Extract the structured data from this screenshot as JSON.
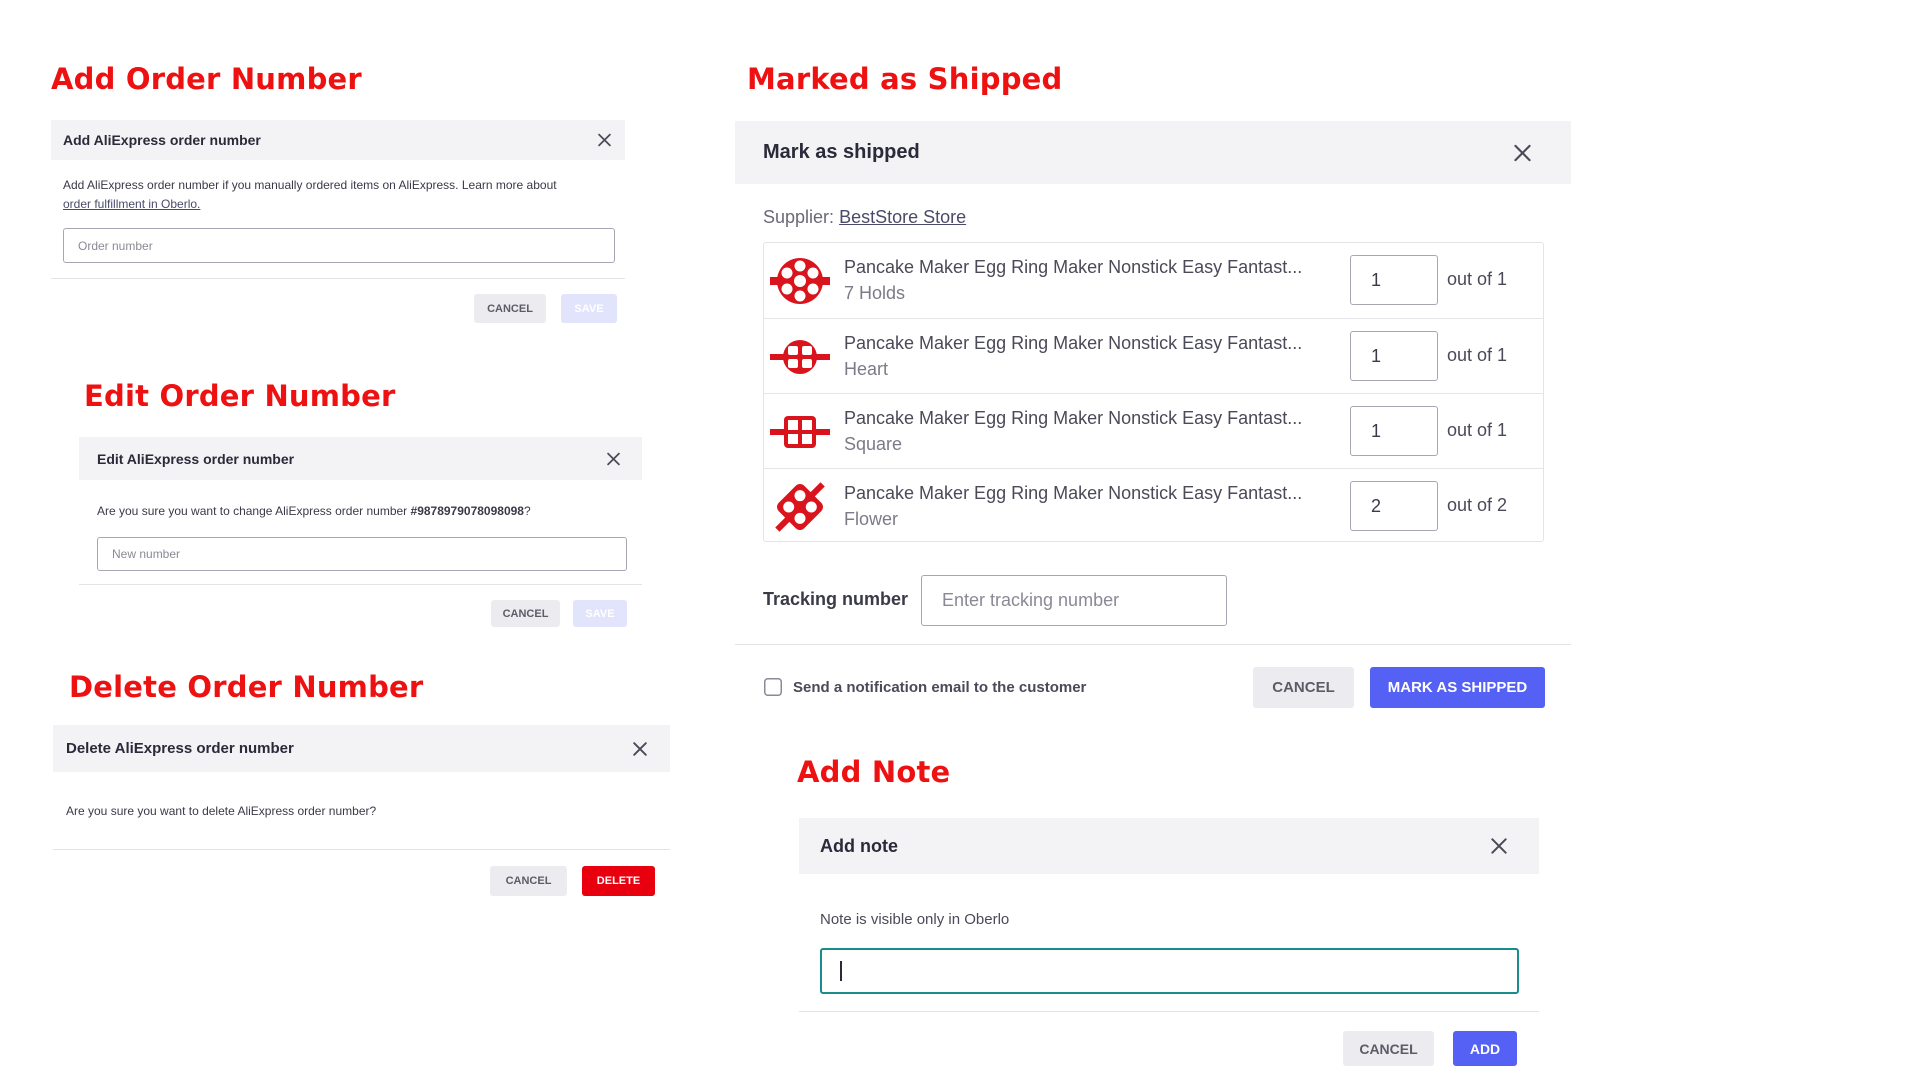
{
  "sections": {
    "add_order": "Add Order Number",
    "edit_order": "Edit Order Number",
    "delete_order": "Delete Order Number",
    "marked_shipped": "Marked as Shipped",
    "add_note": "Add Note"
  },
  "add_order_dialog": {
    "title": "Add AliExpress order number",
    "description": "Add AliExpress order number if you manually ordered items on AliExpress. Learn more about",
    "link_text": "order fulfillment in Oberlo.",
    "input_placeholder": "Order number",
    "cancel_label": "CANCEL",
    "save_label": "SAVE"
  },
  "edit_order_dialog": {
    "title": "Edit AliExpress order number",
    "question_prefix": "Are you sure you want to change AliExpress order number",
    "order_number": "#9878979078098098",
    "question_suffix": "?",
    "input_placeholder": "New number",
    "cancel_label": "CANCEL",
    "save_label": "SAVE"
  },
  "delete_order_dialog": {
    "title": "Delete AliExpress order number",
    "question": "Are you sure you want to delete AliExpress order number?",
    "cancel_label": "CANCEL",
    "delete_label": "DELETE"
  },
  "mark_shipped_dialog": {
    "title": "Mark as shipped",
    "supplier_label": "Supplier:",
    "supplier_name": "BestStore Store",
    "products": [
      {
        "name": "Pancake Maker Egg Ring Maker Nonstick Easy Fantast...",
        "variant": "7 Holds",
        "qty": "1",
        "of_text": "out of 1"
      },
      {
        "name": "Pancake Maker Egg Ring Maker Nonstick Easy Fantast...",
        "variant": "Heart",
        "qty": "1",
        "of_text": "out of 1"
      },
      {
        "name": "Pancake Maker Egg Ring Maker Nonstick Easy Fantast...",
        "variant": "Square",
        "qty": "1",
        "of_text": "out of 1"
      },
      {
        "name": "Pancake Maker Egg Ring Maker Nonstick Easy Fantast...",
        "variant": "Flower",
        "qty": "2",
        "of_text": "out of 2"
      }
    ],
    "tracking_label": "Tracking number",
    "tracking_placeholder": "Enter tracking number",
    "notify_label": "Send a notification email to the customer",
    "notify_checked": false,
    "cancel_label": "CANCEL",
    "confirm_label": "MARK AS SHIPPED"
  },
  "add_note_dialog": {
    "title": "Add note",
    "description": "Note is visible only in Oberlo",
    "input_value": "",
    "cancel_label": "CANCEL",
    "add_label": "ADD"
  },
  "colors": {
    "section_title": "#ee1111",
    "primary": "#5560f5",
    "danger": "#e8000e",
    "note_focus": "#1a8c8c"
  },
  "icons": {
    "close": "close-icon",
    "checkbox": "checkbox-icon",
    "thumbnail": "pancake-mold-thumbnail"
  }
}
